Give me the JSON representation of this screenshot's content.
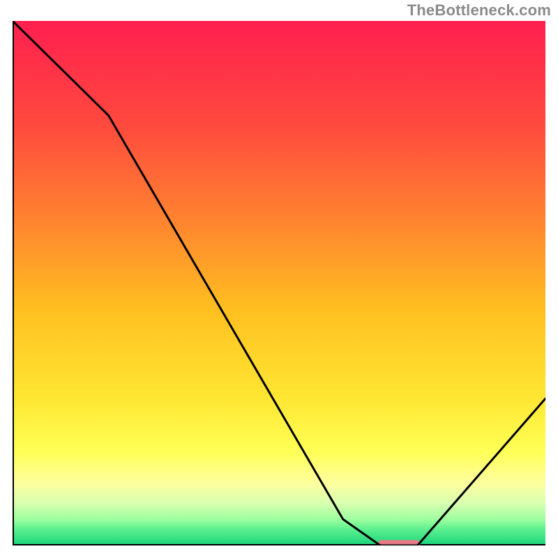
{
  "watermark": "TheBottleneck.com",
  "chart_data": {
    "type": "line",
    "title": "",
    "xlabel": "",
    "ylabel": "",
    "xlim": [
      0,
      100
    ],
    "ylim": [
      0,
      100
    ],
    "grid": false,
    "x": [
      0,
      18,
      62,
      69,
      76,
      100
    ],
    "values": [
      100,
      82,
      5,
      0,
      0,
      28
    ],
    "background": {
      "type": "vertical-gradient",
      "stops": [
        {
          "pos": 0.0,
          "color": "#ff1f4f"
        },
        {
          "pos": 0.2,
          "color": "#ff4a3e"
        },
        {
          "pos": 0.4,
          "color": "#ff8a2e"
        },
        {
          "pos": 0.55,
          "color": "#ffbf20"
        },
        {
          "pos": 0.72,
          "color": "#ffe733"
        },
        {
          "pos": 0.82,
          "color": "#ffff55"
        },
        {
          "pos": 0.88,
          "color": "#ffff9e"
        },
        {
          "pos": 0.92,
          "color": "#d8ffb0"
        },
        {
          "pos": 0.95,
          "color": "#9effa0"
        },
        {
          "pos": 0.97,
          "color": "#5aef8f"
        },
        {
          "pos": 1.0,
          "color": "#19d57a"
        }
      ]
    },
    "marker": {
      "x_center": 72.5,
      "y": 0.3,
      "half_width": 4,
      "color": "#e67a86"
    },
    "axis_color": "#000000",
    "line_color": "#000000"
  }
}
